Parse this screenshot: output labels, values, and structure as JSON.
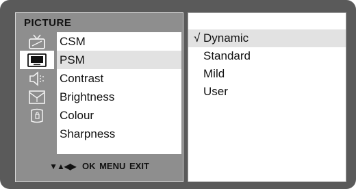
{
  "menu": {
    "title": "PICTURE",
    "items": [
      {
        "label": "CSM"
      },
      {
        "label": "PSM"
      },
      {
        "label": "Contrast"
      },
      {
        "label": "Brightness"
      },
      {
        "label": "Colour"
      },
      {
        "label": "Sharpness"
      }
    ],
    "selected_index": 1,
    "icons": [
      "tv-antenna-icon",
      "picture-icon",
      "speaker-icon",
      "clock-icon",
      "lock-icon"
    ],
    "active_icon_index": 1
  },
  "nav_hint": {
    "arrows": "▼▲◀▶",
    "ok": "OK",
    "menu": "MENU",
    "exit": "EXIT"
  },
  "submenu": {
    "check_mark": "√",
    "options": [
      {
        "label": "Dynamic"
      },
      {
        "label": "Standard"
      },
      {
        "label": "Mild"
      },
      {
        "label": "User"
      }
    ],
    "selected_index": 0
  },
  "colors": {
    "frame": "#5a5a5a",
    "panel": "#8e8e8e",
    "highlight": "#e2e2e2"
  }
}
